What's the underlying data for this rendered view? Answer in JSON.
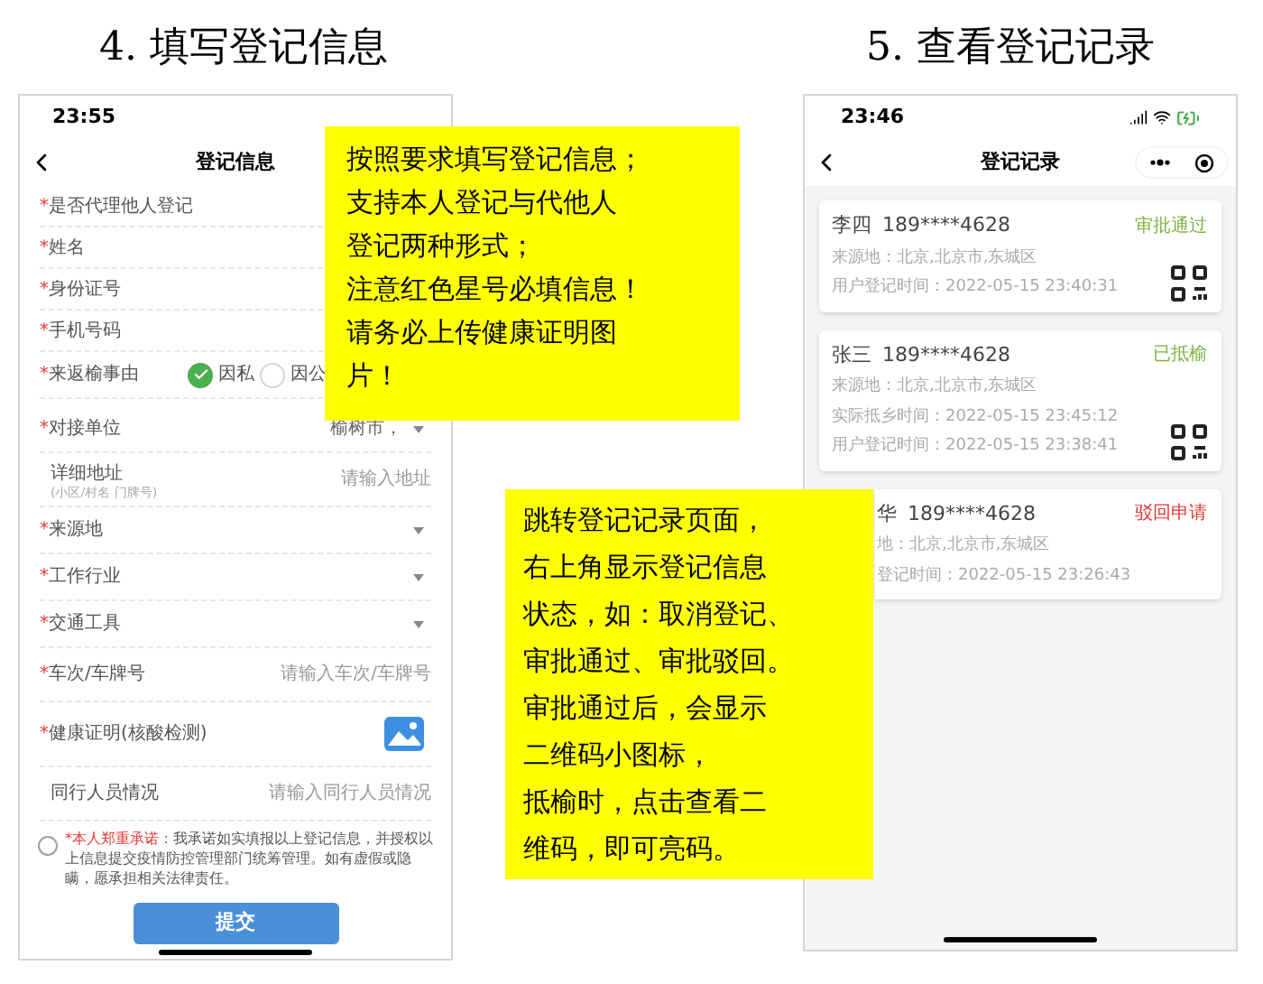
{
  "steps": [
    {
      "title": "4. 填写登记信息"
    },
    {
      "title": "5. 查看登记记录"
    }
  ],
  "form_screen": {
    "time": "23:55",
    "title": "登记信息",
    "rows": [
      {
        "kind": "text",
        "star": "*",
        "label": "是否代理他人登记"
      },
      {
        "kind": "text",
        "star": "*",
        "label": "姓名"
      },
      {
        "kind": "text",
        "star": "*",
        "label": "身份证号"
      },
      {
        "kind": "text",
        "star": "*",
        "label": "手机号码"
      },
      {
        "kind": "radio",
        "star": "*",
        "label": "来返榆事由",
        "options": [
          {
            "label": "因私",
            "selected": true
          },
          {
            "label": "因公",
            "selected": false
          }
        ]
      },
      {
        "kind": "select",
        "star": "*",
        "label": "对接单位",
        "value": "榆树市，"
      },
      {
        "kind": "input",
        "label": "详细地址",
        "sublabel": "(小区/村名 门牌号)",
        "placeholder": "请输入地址"
      },
      {
        "kind": "select",
        "star": "*",
        "label": "来源地"
      },
      {
        "kind": "select",
        "star": "*",
        "label": "工作行业"
      },
      {
        "kind": "select",
        "star": "*",
        "label": "交通工具"
      },
      {
        "kind": "input",
        "star": "*",
        "label": "车次/车牌号",
        "placeholder": "请输入车次/车牌号"
      },
      {
        "kind": "image",
        "star": "*",
        "label": "健康证明(核酸检测)"
      },
      {
        "kind": "input",
        "label": "同行人员情况",
        "placeholder": "请输入同行人员情况"
      }
    ],
    "commitment": {
      "checked": false,
      "lead": "*本人郑重承诺：",
      "text": "我承诺如实填报以上登记信息，并授权以上信息提交疫情防控管理部门统筹管理。如有虚假或隐瞒，愿承担相关法律责任。"
    },
    "submit": "提交"
  },
  "records_screen": {
    "time": "23:46",
    "title": "登记记录",
    "cards": [
      {
        "kind": "full",
        "name": "李四",
        "phone": "189****4628",
        "status": "审批通过",
        "color": "#7cb342",
        "lines": [
          "来源地：北京,北京市,东城区",
          "用户登记时间：2022-05-15 23:40:31"
        ],
        "qr": true
      },
      {
        "kind": "full",
        "name": "张三",
        "phone": "189****4628",
        "status": "已抵榆",
        "color": "#7cb342",
        "lines": [
          "来源地：北京,北京市,东城区",
          "实际抵乡时间：2022-05-15 23:45:12",
          "用户登记时间：2022-05-15 23:38:41"
        ],
        "qr": true
      },
      {
        "kind": "partial",
        "name": "华",
        "phone": "189****4628",
        "status": "驳回申请",
        "color": "#e53935",
        "lines": [
          "地：北京,北京市,东城区",
          "登记时间：2022-05-15 23:26:43"
        ],
        "qr": false
      }
    ]
  },
  "notes": [
    {
      "lines": [
        "按照要求填写登记信息；",
        "支持本人登记与代他人",
        "登记两种形式；",
        "注意红色星号必填信息！",
        "请务必上传健康证明图",
        "片！"
      ]
    },
    {
      "lines": [
        "跳转登记记录页面，",
        "右上角显示登记信息",
        "状态，如：取消登记、",
        "审批通过、审批驳回。",
        "审批通过后，会显示",
        "二维码小图标，",
        "抵榆时，点击查看二",
        "维码，即可亮码。"
      ]
    }
  ]
}
